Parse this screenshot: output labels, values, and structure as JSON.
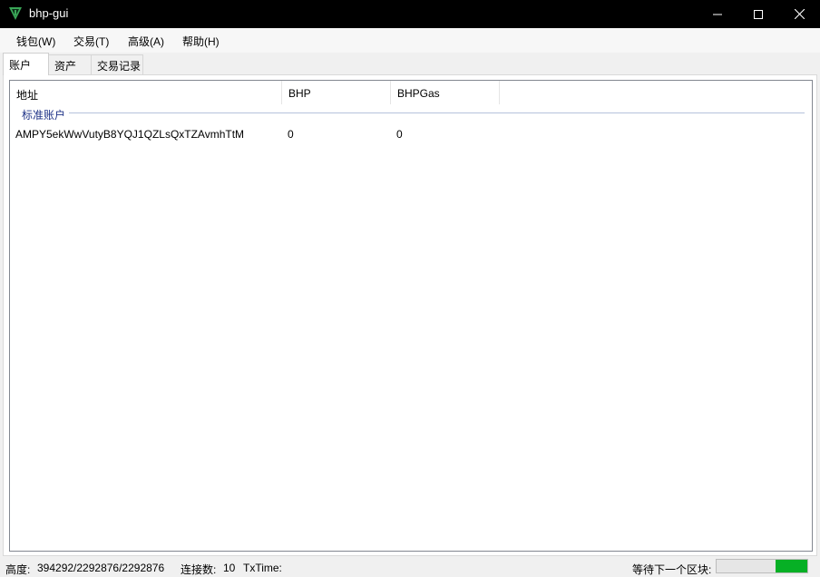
{
  "window": {
    "title": "bhp-gui"
  },
  "menu": [
    {
      "label": "钱包(W)"
    },
    {
      "label": "交易(T)"
    },
    {
      "label": "高级(A)"
    },
    {
      "label": "帮助(H)"
    }
  ],
  "tabs": [
    {
      "label": "账户",
      "active": true
    },
    {
      "label": "资产",
      "active": false
    },
    {
      "label": "交易记录",
      "active": false
    }
  ],
  "accounts": {
    "columns": [
      "地址",
      "BHP",
      "BHPGas"
    ],
    "group_label": "标准账户",
    "rows": [
      {
        "address": "AMPY5ekWwVutyB8YQJ1QZLsQxTZAvmhTtM",
        "bhp": "0",
        "bhpgas": "0"
      }
    ]
  },
  "status": {
    "height_label": "高度:",
    "height_value": "394292/2292876/2292876",
    "connections_label": "连接数:",
    "connections_value": "10",
    "txtime_label": "TxTime:",
    "next_block_label": "等待下一个区块:",
    "next_block_progress": 0.35
  },
  "colors": {
    "accent": "#06b025",
    "group_text": "#1e3287",
    "titlebar": "#000000"
  }
}
